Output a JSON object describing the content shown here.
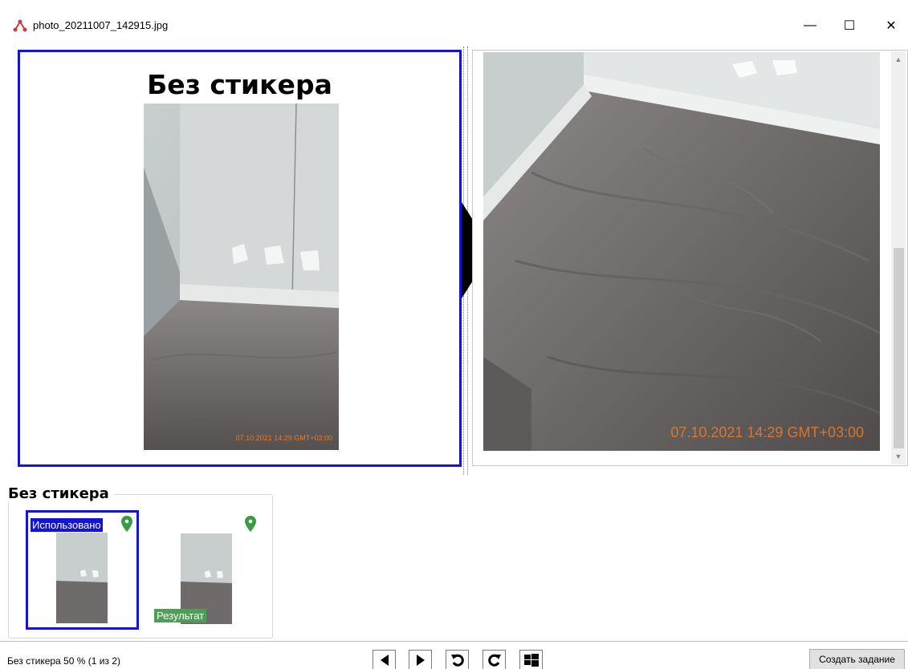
{
  "window": {
    "title": "photo_20211007_142915.jpg",
    "minimize_glyph": "—",
    "maximize_glyph": "☐",
    "close_glyph": "✕"
  },
  "left_card": {
    "title": "Без стикера",
    "timestamp": "07.10.2021 14:29 GMT+03:00"
  },
  "right_panel": {
    "timestamp": "07.10.2021 14:29 GMT+03:00"
  },
  "group": {
    "title": "Без стикера",
    "thumbnails": [
      {
        "badge": "Использовано",
        "pin_icon": "location-pin-icon"
      },
      {
        "badge": "Результат",
        "pin_icon": "location-pin-icon"
      }
    ]
  },
  "status": {
    "text": "Без стикера 50 % (1 из 2)",
    "create_button": "Создать задание",
    "tools": [
      "previous-icon",
      "next-icon",
      "rotate-left-icon",
      "rotate-right-icon",
      "windows-icon"
    ]
  },
  "colors": {
    "selection_blue": "#1414d7",
    "pin_green": "#3a9a45",
    "result_green": "#4e9e55",
    "timestamp_orange": "#e9782a"
  }
}
